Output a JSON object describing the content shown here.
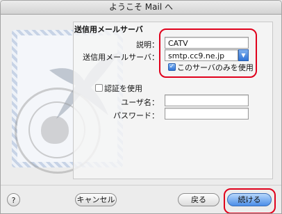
{
  "window": {
    "title": "ようこそ Mail へ"
  },
  "section": {
    "title": "送信用メールサーバ"
  },
  "form": {
    "description_label": "説明：",
    "description_value": "CATV",
    "server_label": "送信用メールサーバ：",
    "server_value": "smtp.cc9.ne.jp",
    "only_this_server_label": "このサーバのみを使用",
    "only_this_server_checked": true,
    "use_auth_label": "認証を使用",
    "use_auth_checked": false,
    "username_label": "ユーザ名：",
    "username_value": "",
    "password_label": "パスワード：",
    "password_value": ""
  },
  "buttons": {
    "help": "?",
    "cancel": "キャンセル",
    "back": "戻る",
    "continue": "続ける"
  },
  "colors": {
    "highlight": "#e0001b",
    "accent": "#2f73d6"
  }
}
